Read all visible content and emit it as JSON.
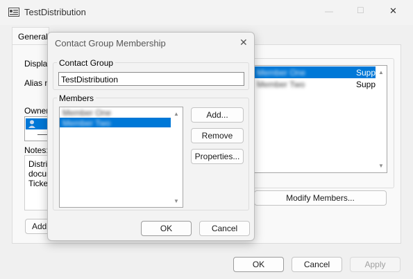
{
  "window": {
    "title": "TestDistribution",
    "icon": "contact-card-icon",
    "controls": {
      "minimize": "—",
      "maximize": "☐",
      "close": "✕"
    }
  },
  "tabs": [
    {
      "label": "General"
    }
  ],
  "properties_form": {
    "display_name_label": "Display",
    "alias_label": "Alias n",
    "owner_label": "Owner",
    "notes_label": "Notes:",
    "notes_lines": [
      "Distrit",
      "docur",
      "Ticket"
    ],
    "add_label": "Add",
    "members_rows": [
      {
        "name": "Member One",
        "company": "Supp",
        "selected": true
      },
      {
        "name": "Member Two",
        "company": "Supp",
        "selected": false
      }
    ],
    "modify_members_label": "Modify Members..."
  },
  "footer": {
    "ok": "OK",
    "cancel": "Cancel",
    "apply": "Apply"
  },
  "dialog": {
    "title": "Contact Group Membership",
    "close": "✕",
    "contact_group": {
      "label": "Contact Group",
      "value": "TestDistribution"
    },
    "members": {
      "label": "Members",
      "items": [
        {
          "name": "Member One",
          "selected": false
        },
        {
          "name": "Member Two",
          "selected": true
        }
      ],
      "add": "Add...",
      "remove": "Remove",
      "properties": "Properties..."
    },
    "ok": "OK",
    "cancel": "Cancel"
  },
  "colors": {
    "selection": "#0078d7",
    "accent_border": "#9a9a9a"
  }
}
